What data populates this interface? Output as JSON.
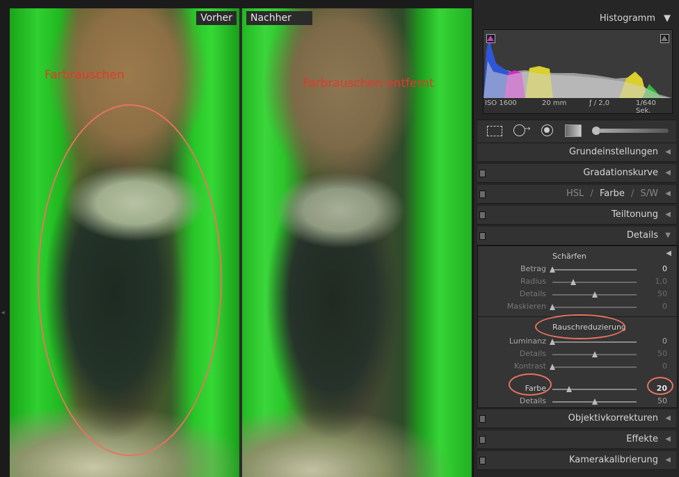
{
  "preview": {
    "before_label": "Vorher",
    "after_label": "Nachher",
    "annotation_before": "Farbrauschen",
    "annotation_after": "Farbrauschen entfernt"
  },
  "panel": {
    "histogram": {
      "title": "Histogramm",
      "iso": "ISO 1600",
      "focal": "20 mm",
      "aperture": "ƒ / 2,0",
      "shutter": "1/640 Sek."
    },
    "sections": {
      "grundeinstellungen": "Grundeinstellungen",
      "gradationskurve": "Gradationskurve",
      "hsl": "HSL",
      "hsl_sep": "/",
      "farbe": "Farbe",
      "sw": "S/W",
      "teiltonung": "Teiltonung",
      "details": "Details",
      "objektivkorrekturen": "Objektivkorrekturen",
      "effekte": "Effekte",
      "kamerakalibrierung": "Kamerakalibrierung"
    },
    "details": {
      "schaerfen_title": "Schärfen",
      "schaerfen": [
        {
          "label": "Betrag",
          "value": "0",
          "pos": 0.0
        },
        {
          "label": "Radius",
          "value": "1,0",
          "pos": 0.25
        },
        {
          "label": "Details",
          "value": "50",
          "pos": 0.5
        },
        {
          "label": "Maskieren",
          "value": "0",
          "pos": 0.0
        }
      ],
      "rausch_title": "Rauschreduzierung",
      "rausch": [
        {
          "label": "Luminanz",
          "value": "0",
          "pos": 0.0
        },
        {
          "label": "Details",
          "value": "50",
          "pos": 0.5
        },
        {
          "label": "Kontrast",
          "value": "0",
          "pos": 0.0
        },
        {
          "label": "Farbe",
          "value": "20",
          "pos": 0.2
        },
        {
          "label": "Details",
          "value": "50",
          "pos": 0.5
        }
      ]
    }
  },
  "colors": {
    "annotation": "#e03a2a",
    "annotation_ring": "#e8735f",
    "panel_bg": "#262626"
  }
}
